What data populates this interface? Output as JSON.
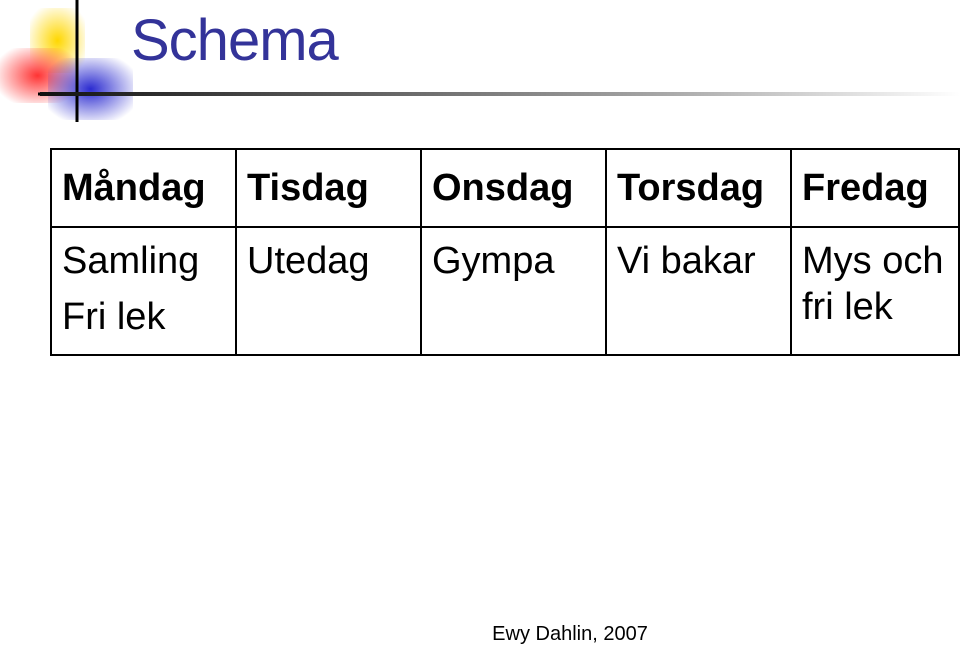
{
  "slide": {
    "title": "Schema",
    "footer": "Ewy Dahlin, 2007",
    "logo": {
      "colors": [
        "#ffd700",
        "#ff3333",
        "#3333cc",
        "#000000"
      ]
    }
  },
  "schedule": {
    "headers": [
      "Måndag",
      "Tisdag",
      "Onsdag",
      "Torsdag",
      "Fredag"
    ],
    "activities": {
      "monday": [
        "Samling",
        "Fri lek"
      ],
      "tuesday": "Utedag",
      "wednesday": "Gympa",
      "thursday": "Vi bakar",
      "friday": "Mys och fri lek"
    }
  }
}
